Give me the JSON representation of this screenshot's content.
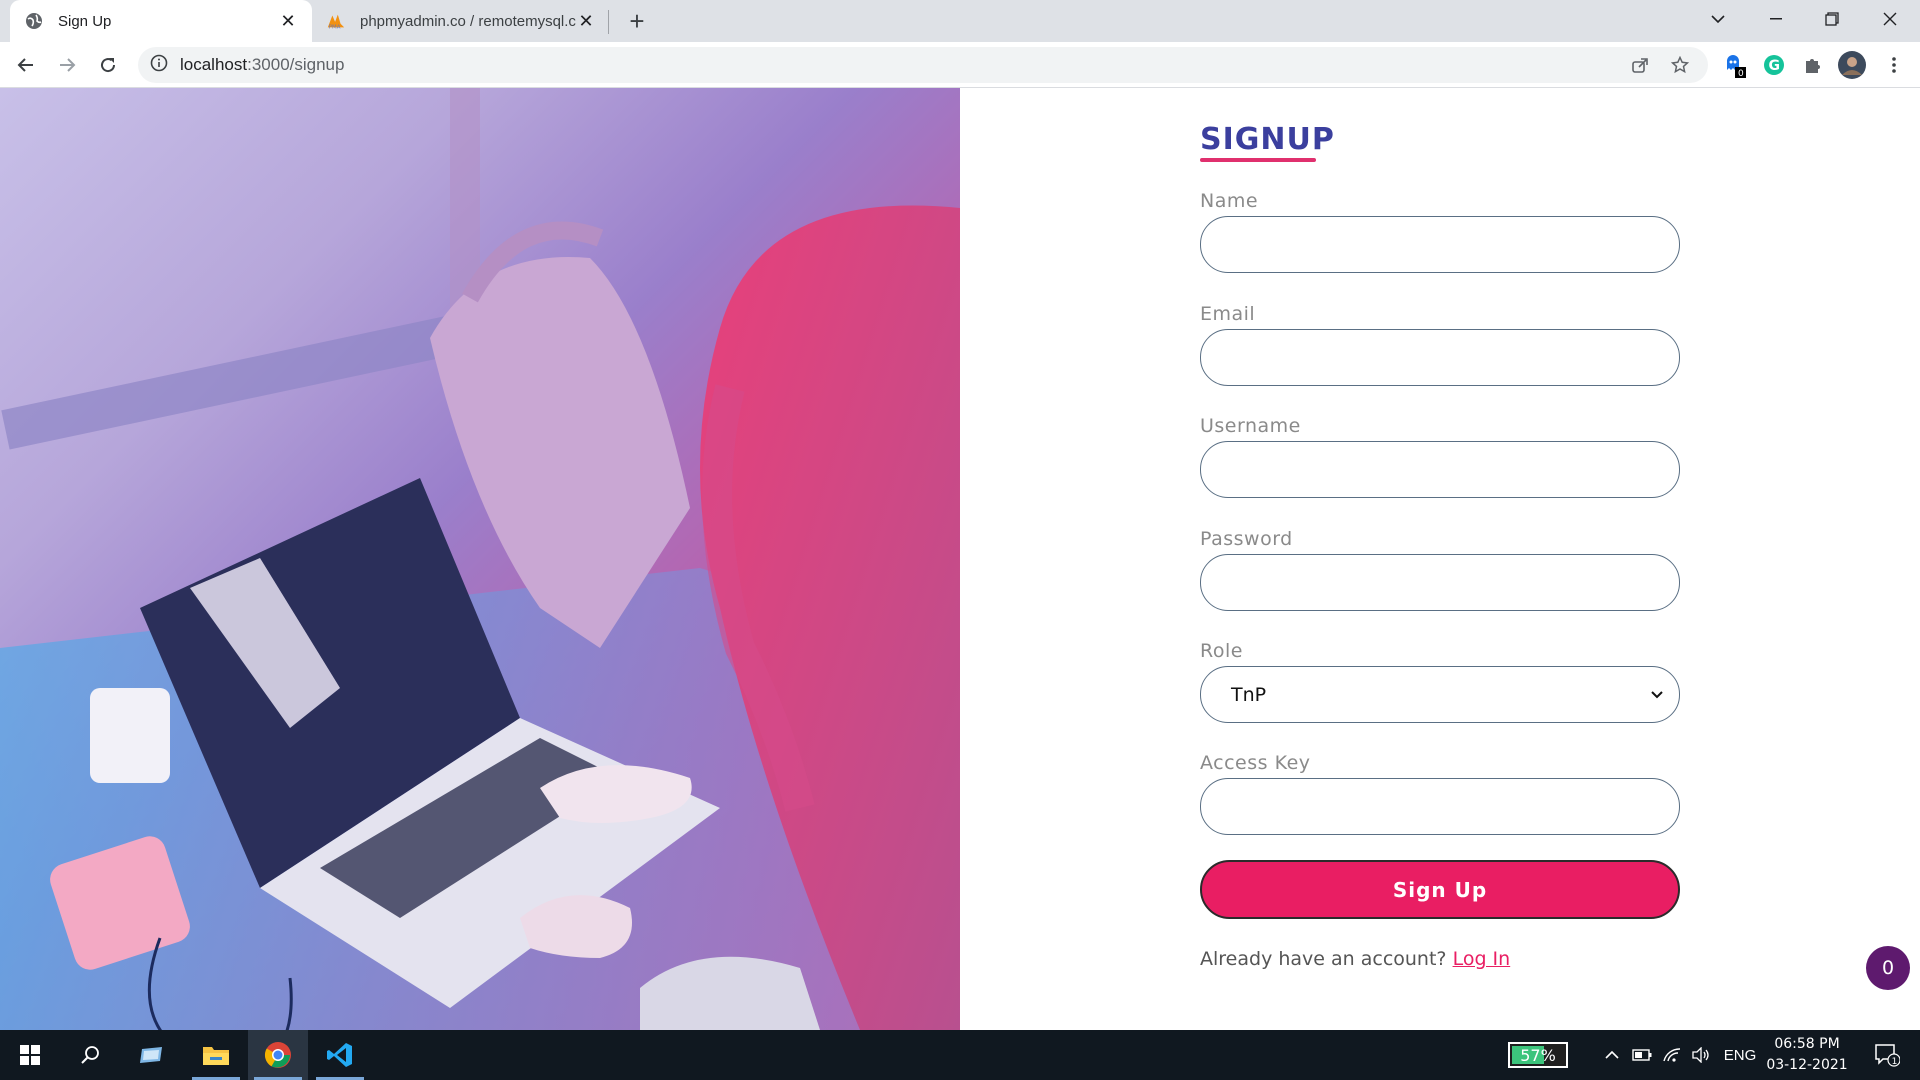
{
  "browser": {
    "tabs": [
      {
        "title": "Sign Up",
        "active": true,
        "favicon": "globe-icon"
      },
      {
        "title": "phpmyadmin.co / remotemysql.c",
        "active": false,
        "favicon": "phpmyadmin-icon"
      }
    ],
    "address": {
      "host": "localhost",
      "path": ":3000/signup"
    },
    "extension_badge": "0"
  },
  "form": {
    "heading": "SIGNUP",
    "fields": [
      {
        "label": "Name",
        "value": ""
      },
      {
        "label": "Email",
        "value": ""
      },
      {
        "label": "Username",
        "value": ""
      },
      {
        "label": "Password",
        "value": ""
      }
    ],
    "role": {
      "label": "Role",
      "selected": "TnP"
    },
    "access_key": {
      "label": "Access Key",
      "value": ""
    },
    "submit_label": "Sign Up",
    "login_prompt": "Already have an account?",
    "login_link": "Log In"
  },
  "floating_badge": "0",
  "taskbar": {
    "battery": "57%",
    "battery_level": 0.57,
    "language": "ENG",
    "time": "06:58 PM",
    "date": "03-12-2021",
    "notification_count": "1"
  },
  "colors": {
    "accent": "#e91e63",
    "heading": "#3b3f9e",
    "tab_bar": "#dee1e6",
    "taskbar": "#101820"
  }
}
